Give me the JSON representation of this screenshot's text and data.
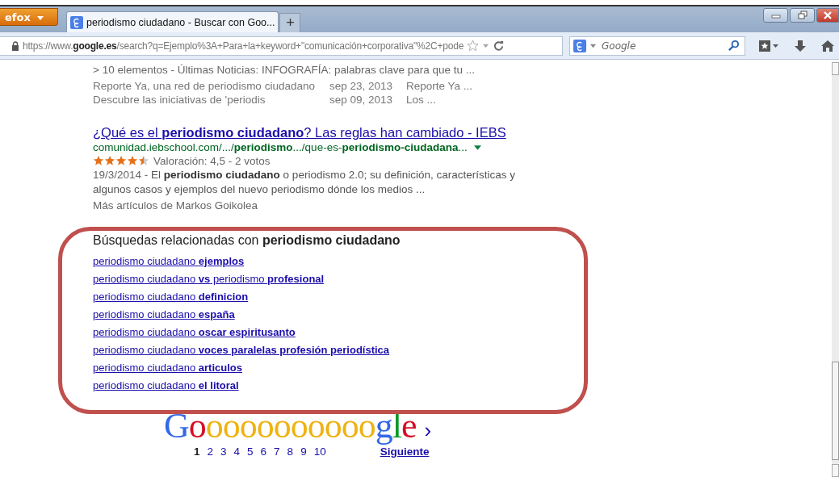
{
  "browser": {
    "menu_button": "efox",
    "tabs": [
      {
        "label": "periodismo ciudadano - Buscar con Goo...",
        "selected": true
      }
    ],
    "new_tab": "+",
    "url": {
      "prefix": "https://www.",
      "domain": "google.es",
      "path": "/search?q=Ejemplo%3A+Para+la+keyword+\"comunicación+corporativa\"%2C+pode"
    },
    "search": {
      "placeholder": "Google"
    }
  },
  "sitelinks": {
    "summary": "> 10 elementos - Últimas Noticias: INFOGRAFÍA: palabras clave para que tu ...",
    "rows": [
      [
        "Reporte Ya, una red de periodismo ciudadano",
        "sep 23, 2013",
        "Reporte Ya ..."
      ],
      [
        "Descubre las iniciativas de 'periodis",
        "sep 09, 2013",
        "Los ..."
      ]
    ]
  },
  "result": {
    "title": "¿Qué es el **periodismo ciudadano**? Las reglas han cambiado - IEBS",
    "url": "comunidad.iebschool.com/.../**periodismo**.../que-es-**periodismo-ciudadana**...",
    "stars": 4.5,
    "rating": "Valoración: 4,5 - 2 votos",
    "date": "19/3/2014 - ",
    "snippet": "El **periodismo ciudadano** o periodismo 2.0; su definición, características y algunos casos y ejemplos del nuevo periodismo dónde los medios ...",
    "more": "Más artículos de Markos Goikolea"
  },
  "related": {
    "heading": "Búsquedas relacionadas con **periodismo ciudadano**",
    "links": [
      "periodismo ciudadano **ejemplos**",
      "periodismo ciudadano **vs** periodismo **profesional**",
      "periodismo ciudadano **definicion**",
      "periodismo ciudadano **españa**",
      "periodismo ciudadano **oscar espiritusanto**",
      "periodismo ciudadano **voces paralelas profesión periodística**",
      "periodismo ciudadano **articulos**",
      "periodismo ciudadano **el litoral**"
    ]
  },
  "pagination": {
    "logo": "Gooooooooooogle",
    "arrow": "›",
    "pages": [
      {
        "label": "1",
        "selected": true
      },
      {
        "label": "2",
        "selected": false
      },
      {
        "label": "3",
        "selected": false
      },
      {
        "label": "4",
        "selected": false
      },
      {
        "label": "5",
        "selected": false
      },
      {
        "label": "6",
        "selected": false
      },
      {
        "label": "7",
        "selected": false
      },
      {
        "label": "8",
        "selected": false
      },
      {
        "label": "9",
        "selected": false
      },
      {
        "label": "10",
        "selected": false
      }
    ],
    "next": "Siguiente"
  }
}
